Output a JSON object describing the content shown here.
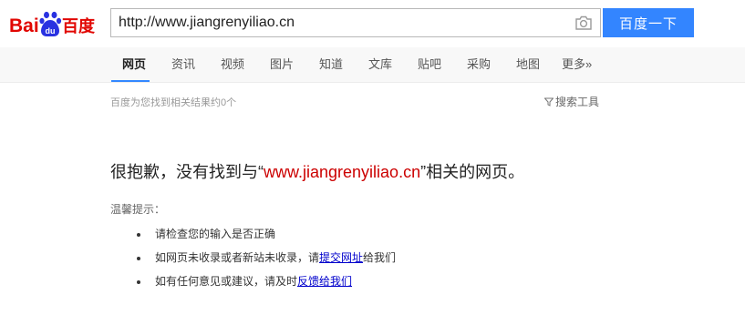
{
  "logo": {
    "text_left": "Bai",
    "text_paw": "du",
    "text_right": "百度",
    "color_red": "#e10602",
    "color_blue": "#2932e1"
  },
  "search": {
    "query": "http://www.jiangrenyiliao.cn",
    "button_label": "百度一下",
    "camera_icon": "camera-icon"
  },
  "nav": {
    "items": [
      {
        "label": "网页",
        "active": true
      },
      {
        "label": "资讯"
      },
      {
        "label": "视频"
      },
      {
        "label": "图片"
      },
      {
        "label": "知道"
      },
      {
        "label": "文库"
      },
      {
        "label": "贴吧"
      },
      {
        "label": "采购"
      },
      {
        "label": "地图"
      },
      {
        "label": "更多»"
      }
    ]
  },
  "results": {
    "count_text": "百度为您找到相关结果约0个",
    "search_tools": "搜索工具"
  },
  "message": {
    "prefix": "很抱歉，没有找到与“",
    "query": "www.jiangrenyiliao.cn",
    "suffix": "”相关的网页。"
  },
  "tips": {
    "title": "温馨提示：",
    "item1": "请检查您的输入是否正确",
    "item2_prefix": "如网页未收录或者新站未收录，请",
    "item2_link": "提交网址",
    "item2_suffix": "给我们",
    "item3_prefix": "如有任何意见或建议，请及时",
    "item3_link": "反馈给我们"
  },
  "colors": {
    "accent": "#3385ff",
    "query_red": "#c00000",
    "link": "#0000cc"
  }
}
